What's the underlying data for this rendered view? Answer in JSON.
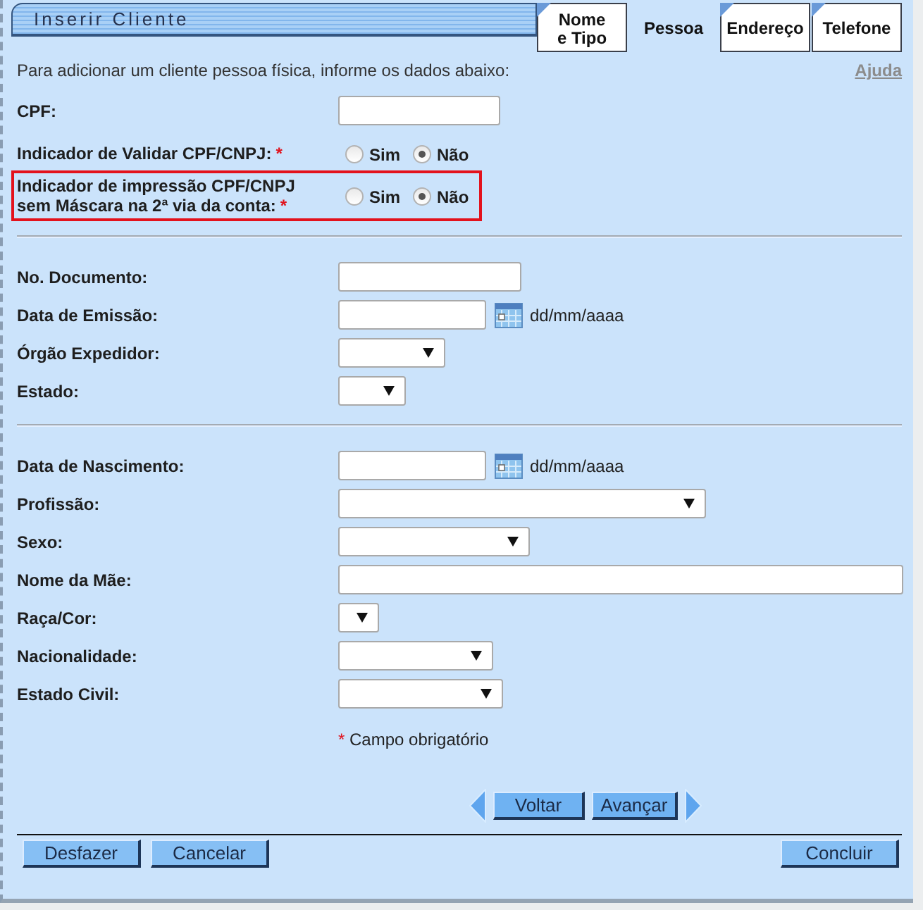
{
  "header": {
    "title": "Inserir Cliente"
  },
  "tabs": [
    {
      "label": "Nome\ne Tipo",
      "selected": false
    },
    {
      "label": "Pessoa",
      "selected": true
    },
    {
      "label": "Endereço",
      "selected": false
    },
    {
      "label": "Telefone",
      "selected": false
    }
  ],
  "intro": {
    "text": "Para adicionar um cliente pessoa física, informe os dados abaixo:",
    "help_link": "Ajuda"
  },
  "sections": [
    {
      "fields": [
        {
          "kind": "text",
          "label": "CPF:",
          "highlighted": false
        },
        {
          "kind": "radio",
          "label": "Indicador de Validar CPF/CNPJ:",
          "required_mark": "*",
          "highlighted": false,
          "options": [
            {
              "label": "Sim",
              "selected": false
            },
            {
              "label": "Não",
              "selected": true
            }
          ]
        },
        {
          "kind": "radio",
          "label": "Indicador de impressão CPF/CNPJ sem Máscara na 2ª via da conta:",
          "required_mark": "*",
          "highlighted": true,
          "options": [
            {
              "label": "Sim",
              "selected": false
            },
            {
              "label": "Não",
              "selected": true
            }
          ]
        }
      ]
    },
    {
      "fields": [
        {
          "kind": "text",
          "label": "No. Documento:",
          "highlighted": false
        },
        {
          "kind": "date",
          "label": "Data de Emissão:",
          "format_hint": "dd/mm/aaaa",
          "highlighted": false
        },
        {
          "kind": "select",
          "label": "Órgão Expedidor:",
          "highlighted": false
        },
        {
          "kind": "select",
          "label": "Estado:",
          "highlighted": false
        }
      ]
    },
    {
      "fields": [
        {
          "kind": "date",
          "label": "Data de Nascimento:",
          "format_hint": "dd/mm/aaaa",
          "highlighted": false
        },
        {
          "kind": "select",
          "label": "Profissão:",
          "highlighted": false
        },
        {
          "kind": "select",
          "label": "Sexo:",
          "highlighted": false
        },
        {
          "kind": "text",
          "label": "Nome da Mãe:",
          "highlighted": false
        },
        {
          "kind": "select",
          "label": "Raça/Cor:",
          "highlighted": false
        },
        {
          "kind": "select",
          "label": "Nacionalidade:",
          "highlighted": false
        },
        {
          "kind": "select",
          "label": "Estado Civil:",
          "highlighted": false
        }
      ],
      "note": {
        "mark": "*",
        "text": "Campo obrigatório"
      }
    }
  ],
  "navigation": {
    "back": "Voltar",
    "next": "Avançar"
  },
  "actions": {
    "left": [
      "Desfazer",
      "Cancelar"
    ],
    "right": [
      "Concluir"
    ]
  }
}
